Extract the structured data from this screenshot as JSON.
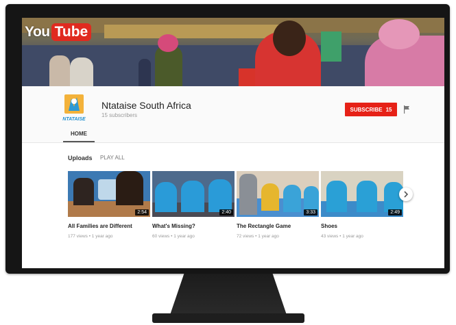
{
  "brand": {
    "logo_you": "You",
    "logo_tube": "Tube",
    "accent": "#e62117"
  },
  "channel": {
    "name": "Ntataise South Africa",
    "subscribers": "15 subscribers",
    "logo_text": "NTATAISE"
  },
  "subscribe": {
    "label": "SUBSCRIBE",
    "count": "15"
  },
  "tabs": [
    {
      "label": "HOME"
    }
  ],
  "uploads": {
    "label": "Uploads",
    "play_all": "PLAY ALL"
  },
  "videos": [
    {
      "title": "All Families are Different",
      "duration": "2:54",
      "views": "177 views",
      "age": "1 year ago"
    },
    {
      "title": "What's Missing?",
      "duration": "2:40",
      "views": "60 views",
      "age": "1 year ago"
    },
    {
      "title": "The Rectangle Game",
      "duration": "3:33",
      "views": "72 views",
      "age": "1 year ago"
    },
    {
      "title": "Shoes",
      "duration": "2:49",
      "views": "43 views",
      "age": "1 year ago"
    }
  ],
  "icons": {
    "flag": "flag-icon",
    "next": "chevron-right-icon"
  }
}
